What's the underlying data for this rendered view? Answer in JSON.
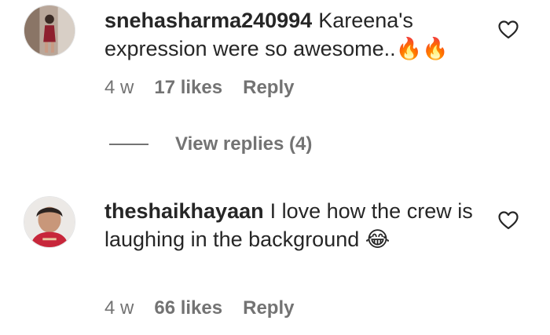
{
  "comments": [
    {
      "username": "snehasharma240994",
      "text": "Kareena's expression were so awesome..🔥🔥",
      "time": "4 w",
      "likes": "17 likes",
      "reply_label": "Reply"
    },
    {
      "username": "theshaikhayaan",
      "text": "I love how the crew is laughing in the background 😂",
      "time": "4 w",
      "likes": "66 likes",
      "reply_label": "Reply"
    }
  ],
  "view_replies": "View replies (4)",
  "icons": {
    "like": "heart-outline-icon"
  },
  "colors": {
    "text": "#262626",
    "secondary": "#737373",
    "background": "#ffffff"
  }
}
